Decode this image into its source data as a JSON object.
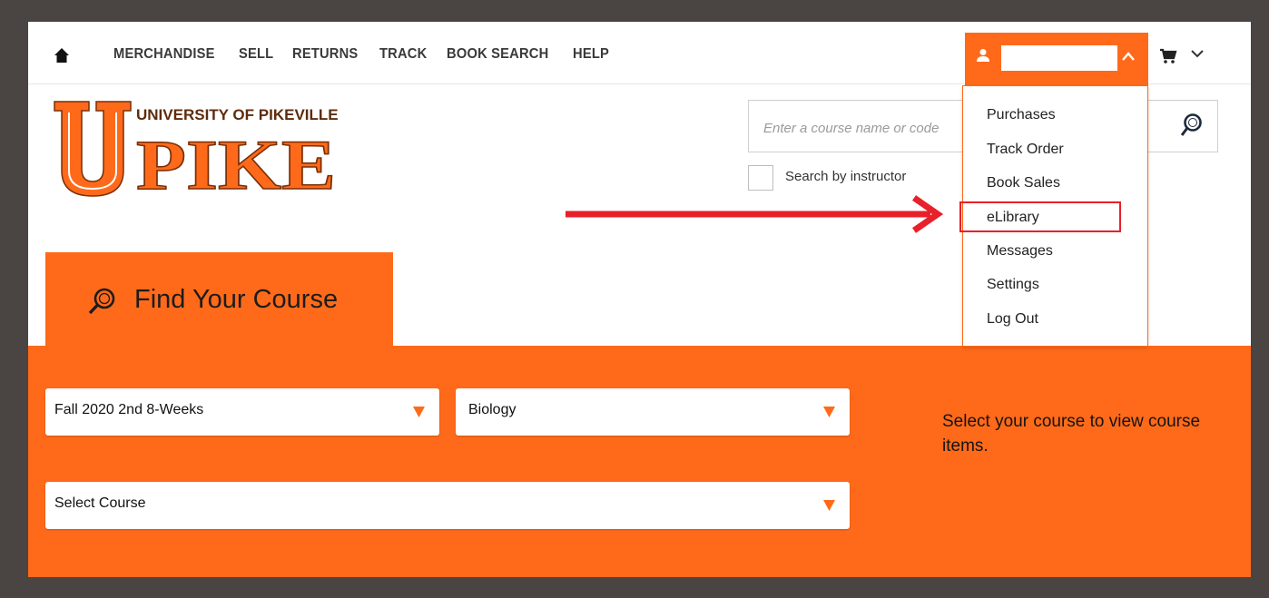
{
  "nav": {
    "links": [
      "MERCHANDISE",
      "SELL",
      "RETURNS",
      "TRACK",
      "BOOK SEARCH",
      "HELP"
    ]
  },
  "logo": {
    "line1": "UNIVERSITY OF PIKEVILLE",
    "line2": "PIKE",
    "letter": "U"
  },
  "search": {
    "placeholder": "Enter a course name or code",
    "instructor_label": "Search by instructor"
  },
  "account_menu": {
    "items": [
      "Purchases",
      "Track Order",
      "Book Sales",
      "eLibrary",
      "Messages",
      "Settings",
      "Log Out"
    ],
    "highlighted": "eLibrary"
  },
  "course_finder": {
    "tab_label": "Find Your Course",
    "term_value": "Fall 2020 2nd 8-Weeks",
    "department_value": "Biology",
    "course_value": "Select Course",
    "note": "Select your course to view course items."
  },
  "colors": {
    "brand_orange": "#ff6a1a",
    "highlight_red": "#e8202a",
    "frame_bg": "#4a4442"
  },
  "icons": [
    "home-icon",
    "user-icon",
    "chevron-up-icon",
    "cart-icon",
    "chevron-down-icon",
    "course-search-icon",
    "dropdown-arrow-icon"
  ]
}
